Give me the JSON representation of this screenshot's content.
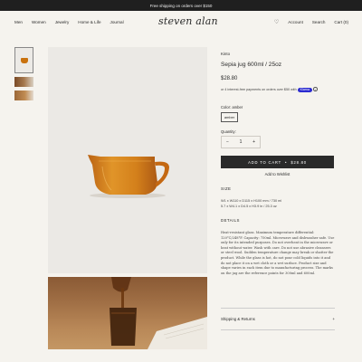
{
  "announcement": "Free shipping on orders over $150",
  "nav": {
    "left": [
      "Men",
      "Women",
      "Jewelry",
      "Home & Life",
      "Journal"
    ],
    "logo": "steven alan",
    "account": "Account",
    "search": "Search",
    "cart": "Cart (0)"
  },
  "product": {
    "vendor": "Kinto",
    "title": "Sepia jug 600ml / 25oz",
    "price": "$28.80",
    "installment_text": "or 4 interest-free payments on orders over $50 with",
    "installment_brand": "Klarna",
    "color_label": "Color: amber",
    "color_option": "amber",
    "quantity_label": "Quantity:",
    "quantity": "1",
    "add_to_cart": "ADD TO CART",
    "add_to_cart_price": "$28.80",
    "wishlist": "Add to Wishlist",
    "size_heading": "SIZE",
    "size_lines": [
      "W1 x W110 x D115 x H100 mm / 730 ml",
      "5.7 x W4.1 x D4.5 x H3.9 in / 25.3 oz"
    ],
    "details_heading": "DETAILS",
    "details_text": "Heat-resistant glass. Maximum temperature differential: 120°C/248°F. Capacity: 750ml. Microwave and dishwasher safe. Use only for its intended purposes. Do not overheat in the microwave or heat without water. Wash with care. Do not use abrasive cleansers or steel wool. Sudden temperature change may break or shatter the product. While the glass is hot, do not pour cold liquids into it and do not place it on a wet cloth or a wet surface. Product size and shape varies in each item due to manufacturing process. The marks on the jug are the reference points for 300ml and 600ml.",
    "accordion_label": "Shipping & Returns"
  },
  "colors": {
    "accent": "#2a2a2a",
    "jug": "#c9720e",
    "background": "#f5f3ee"
  }
}
